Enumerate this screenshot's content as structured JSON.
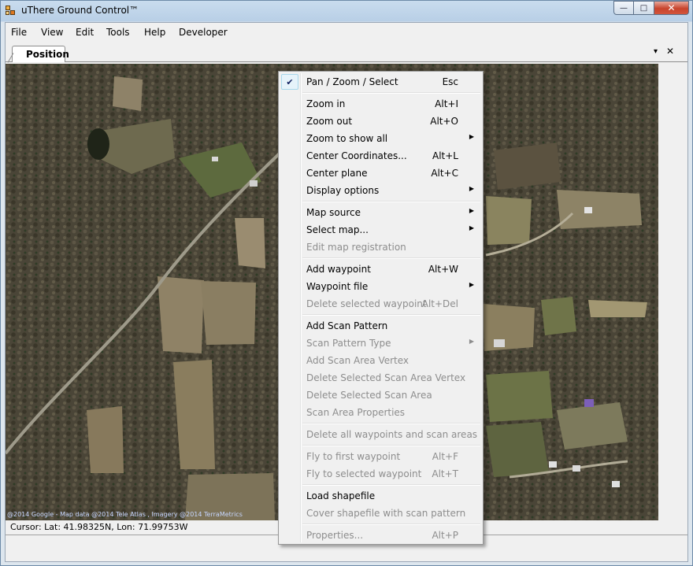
{
  "window": {
    "title": "uThere Ground Control™",
    "controls": {
      "minimize": "—",
      "maximize": "□",
      "close": "✕"
    }
  },
  "menubar": [
    "File",
    "View",
    "Edit",
    "Tools",
    "Help",
    "Developer"
  ],
  "tabs": {
    "active": "Position",
    "dropdown_icon": "chevron-down-icon",
    "close_icon": "close-icon",
    "dropdown_glyph": "▾",
    "close_glyph": "✕"
  },
  "map": {
    "attribution": "@2014 Google - Map data @2014 Tele Atlas , Imagery @2014 TerraMetrics"
  },
  "status": {
    "cursor": "Cursor: Lat: 41.98325N, Lon: 71.99753W"
  },
  "context_menu": {
    "items": [
      {
        "label": "Pan / Zoom / Select",
        "shortcut": "Esc",
        "checked": true,
        "enabled": true
      },
      {
        "separator": true
      },
      {
        "label": "Zoom in",
        "shortcut": "Alt+I",
        "enabled": true
      },
      {
        "label": "Zoom out",
        "shortcut": "Alt+O",
        "enabled": true
      },
      {
        "label": "Zoom to show all",
        "submenu": true,
        "enabled": true
      },
      {
        "label": "Center Coordinates...",
        "shortcut": "Alt+L",
        "enabled": true
      },
      {
        "label": "Center plane",
        "shortcut": "Alt+C",
        "enabled": true
      },
      {
        "label": "Display options",
        "submenu": true,
        "enabled": true
      },
      {
        "separator": true
      },
      {
        "label": "Map source",
        "submenu": true,
        "enabled": true
      },
      {
        "label": "Select map...",
        "submenu": true,
        "enabled": true
      },
      {
        "label": "Edit map registration",
        "enabled": false
      },
      {
        "separator": true
      },
      {
        "label": "Add waypoint",
        "shortcut": "Alt+W",
        "enabled": true
      },
      {
        "label": "Waypoint file",
        "submenu": true,
        "enabled": true
      },
      {
        "label": "Delete selected waypoint",
        "shortcut": "Alt+Del",
        "enabled": false
      },
      {
        "separator": true
      },
      {
        "label": "Add Scan Pattern",
        "enabled": true
      },
      {
        "label": "Scan Pattern Type",
        "submenu": true,
        "enabled": false
      },
      {
        "label": "Add Scan Area Vertex",
        "enabled": false
      },
      {
        "label": "Delete Selected Scan Area Vertex",
        "enabled": false
      },
      {
        "label": "Delete Selected Scan Area",
        "enabled": false
      },
      {
        "label": "Scan Area Properties",
        "enabled": false
      },
      {
        "separator": true
      },
      {
        "label": "Delete all waypoints and scan areas",
        "enabled": false
      },
      {
        "separator": true
      },
      {
        "label": "Fly to first waypoint",
        "shortcut": "Alt+F",
        "enabled": false
      },
      {
        "label": "Fly to selected waypoint",
        "shortcut": "Alt+T",
        "enabled": false
      },
      {
        "separator": true
      },
      {
        "label": "Load shapefile",
        "enabled": true
      },
      {
        "label": "Cover shapefile with scan pattern",
        "enabled": false
      },
      {
        "separator": true
      },
      {
        "label": "Properties...",
        "shortcut": "Alt+P",
        "enabled": false
      }
    ],
    "check_glyph": "✔",
    "submenu_glyph": "▶"
  }
}
